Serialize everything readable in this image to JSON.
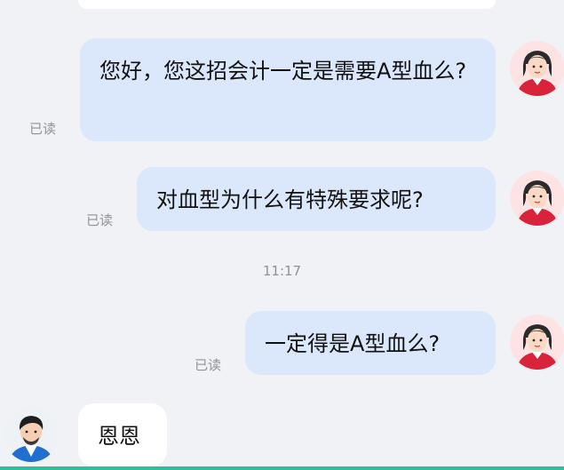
{
  "messages": [
    {
      "text": "您好，您这招会计一定是需要A型血么?",
      "status": "已读"
    },
    {
      "text": "对血型为什么有特殊要求呢?",
      "status": "已读"
    },
    {
      "text": "一定得是A型血么?",
      "status": "已读"
    },
    {
      "text": "恩恩"
    }
  ],
  "timestamp": "11:17",
  "avatars": {
    "self": "female-avatar-icon",
    "other": "male-avatar-icon"
  },
  "colors": {
    "background": "#f1f2f5",
    "outgoing_bubble": "#dbe8fb",
    "incoming_bubble": "#ffffff",
    "read_status": "#8e929a",
    "accent_line": "#2fbf9d"
  }
}
